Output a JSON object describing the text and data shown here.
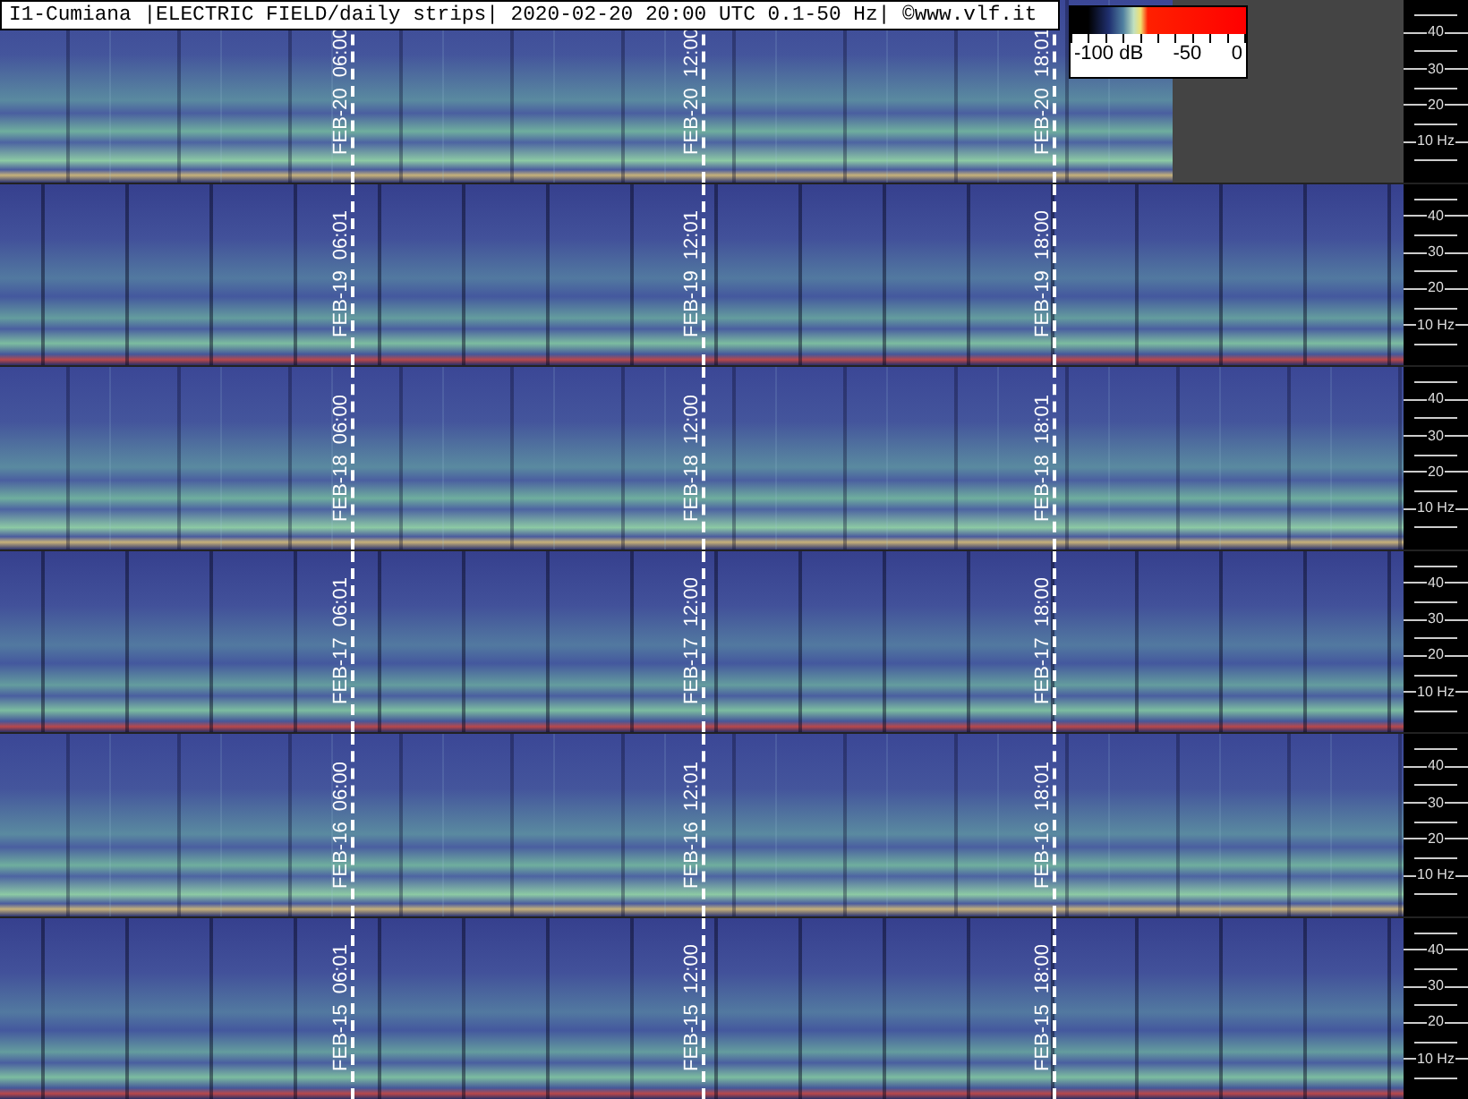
{
  "title": "I1-Cumiana |ELECTRIC FIELD/daily strips| 2020-02-20 20:00 UTC 0.1-50 Hz| ©www.vlf.it",
  "colorbar": {
    "labels": [
      "-100 dB",
      "-50",
      "0"
    ]
  },
  "strips": [
    {
      "partial": true,
      "markers": [
        {
          "date": "FEB-20",
          "time": "06:00"
        },
        {
          "date": "FEB-20",
          "time": "12:00"
        },
        {
          "date": "FEB-20",
          "time": "18:01"
        }
      ],
      "axis_labels": [
        "40",
        "30",
        "20",
        "10 Hz"
      ]
    },
    {
      "partial": false,
      "markers": [
        {
          "date": "FEB-19",
          "time": "06:01"
        },
        {
          "date": "FEB-19",
          "time": "12:01"
        },
        {
          "date": "FEB-19",
          "time": "18:00"
        }
      ],
      "axis_labels": [
        "40",
        "30",
        "20",
        "10 Hz"
      ]
    },
    {
      "partial": false,
      "markers": [
        {
          "date": "FEB-18",
          "time": "06:00"
        },
        {
          "date": "FEB-18",
          "time": "12:00"
        },
        {
          "date": "FEB-18",
          "time": "18:01"
        }
      ],
      "axis_labels": [
        "40",
        "30",
        "20",
        "10 Hz"
      ]
    },
    {
      "partial": false,
      "markers": [
        {
          "date": "FEB-17",
          "time": "06:01"
        },
        {
          "date": "FEB-17",
          "time": "12:00"
        },
        {
          "date": "FEB-17",
          "time": "18:00"
        }
      ],
      "axis_labels": [
        "40",
        "30",
        "20",
        "10 Hz"
      ]
    },
    {
      "partial": false,
      "markers": [
        {
          "date": "FEB-16",
          "time": "06:00"
        },
        {
          "date": "FEB-16",
          "time": "12:01"
        },
        {
          "date": "FEB-16",
          "time": "18:01"
        }
      ],
      "axis_labels": [
        "40",
        "30",
        "20",
        "10 Hz"
      ]
    },
    {
      "partial": false,
      "markers": [
        {
          "date": "FEB-15",
          "time": "06:01"
        },
        {
          "date": "FEB-15",
          "time": "12:00"
        },
        {
          "date": "FEB-15",
          "time": "18:00"
        }
      ],
      "axis_labels": [
        "40",
        "30",
        "20",
        "10 Hz"
      ]
    }
  ]
}
